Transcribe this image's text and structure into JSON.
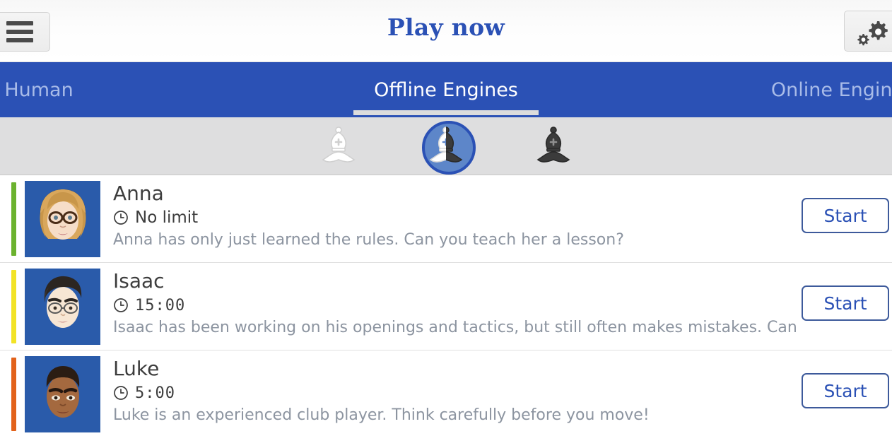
{
  "header": {
    "title": "Play now",
    "menu_icon": "hamburger-menu-icon",
    "settings_icon": "gears-settings-icon"
  },
  "tabs": [
    {
      "label": "Human",
      "active": false
    },
    {
      "label": "Offline Engines",
      "active": true
    },
    {
      "label": "Online Engines",
      "active": false
    }
  ],
  "side_selector": {
    "options": [
      {
        "name": "play-as-white",
        "icon": "white-bishop-icon",
        "selected": false
      },
      {
        "name": "play-random",
        "icon": "random-bishop-icon",
        "selected": true
      },
      {
        "name": "play-as-black",
        "icon": "black-bishop-icon",
        "selected": false
      }
    ]
  },
  "opponents": [
    {
      "name": "Anna",
      "time": "No limit",
      "time_digital": false,
      "description": "Anna has only just learned the rules. Can you teach her a lesson?",
      "difficulty_color": "#6bb22e",
      "start_label": "Start",
      "clock_icon": "clock-icon",
      "avatar": "anna-avatar"
    },
    {
      "name": "Isaac",
      "time": "15:00",
      "time_digital": true,
      "description": "Isaac has been working on his openings and tactics, but still often makes mistakes. Can you ...",
      "difficulty_color": "#f2e326",
      "start_label": "Start",
      "clock_icon": "clock-icon",
      "avatar": "isaac-avatar"
    },
    {
      "name": "Luke",
      "time": "5:00",
      "time_digital": true,
      "description": "Luke is an experienced club player. Think carefully before you move!",
      "difficulty_color": "#e2621b",
      "start_label": "Start",
      "clock_icon": "clock-icon",
      "avatar": "luke-avatar"
    }
  ],
  "colors": {
    "brand_blue": "#2b51b5",
    "tab_inactive": "#a8bbe8",
    "selector_bg": "#dededf",
    "avatar_bg": "#2a5baa",
    "description_text": "#8c94a0"
  }
}
